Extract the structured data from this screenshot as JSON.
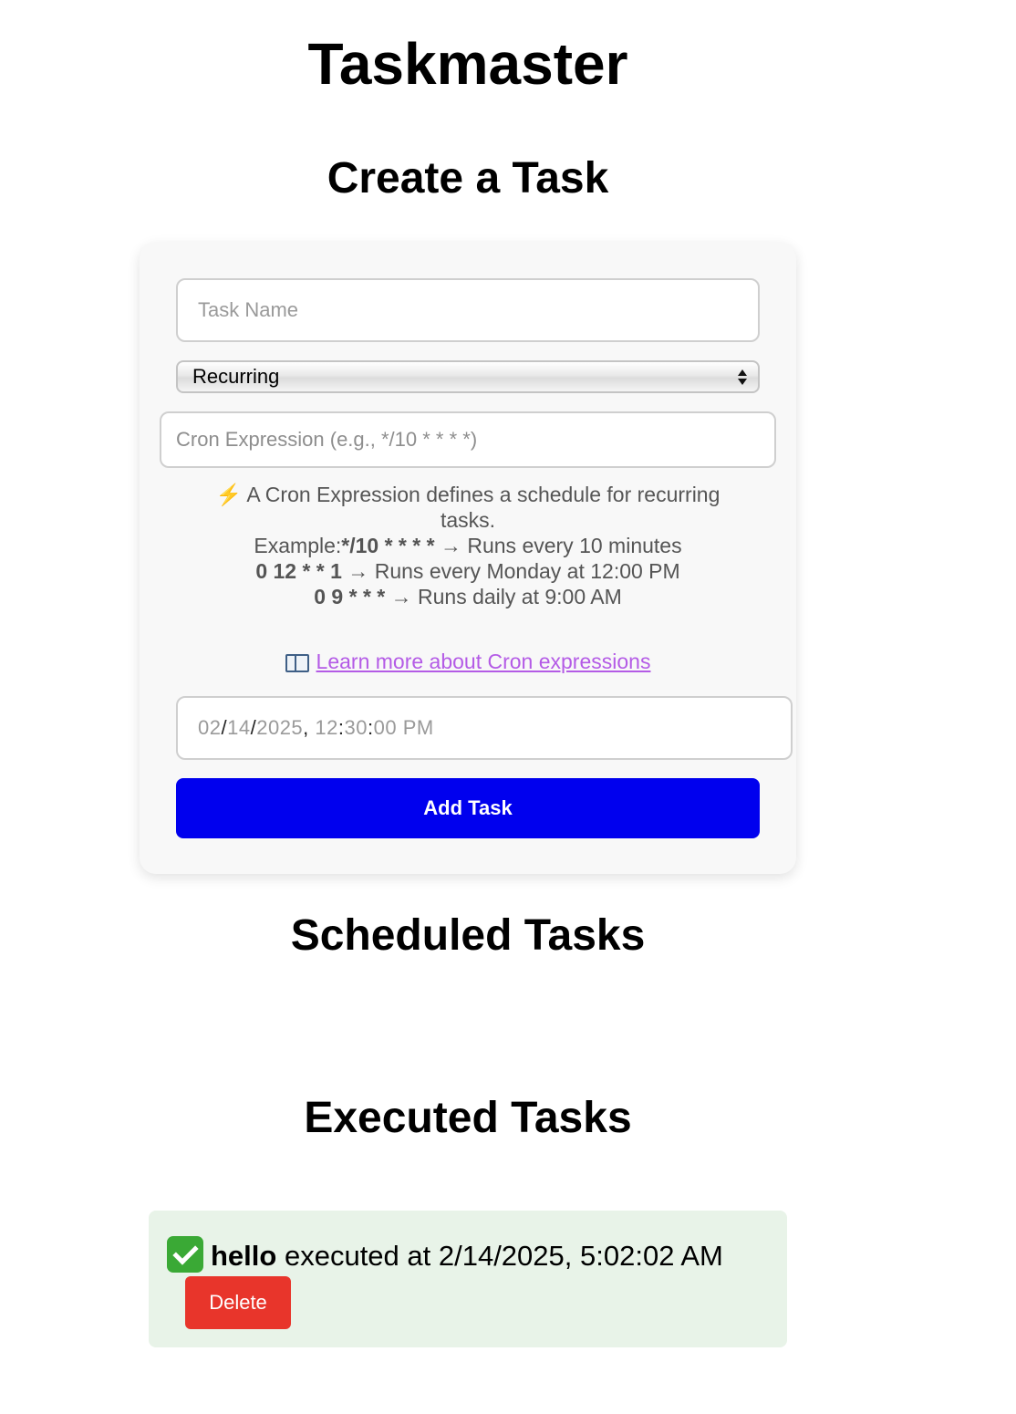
{
  "app": {
    "title": "Taskmaster"
  },
  "create": {
    "title": "Create a Task",
    "task_name_placeholder": "Task Name",
    "task_name_value": "",
    "type_select": {
      "selected": "Recurring",
      "icon": "updown-arrows-icon"
    },
    "cron_placeholder": "Cron Expression (e.g., */10 * * * *)",
    "cron_value": "",
    "help": {
      "icon": "lightning-bolt-icon",
      "bolt_glyph": "⚡",
      "intro": "A Cron Expression defines a schedule for recurring tasks.",
      "example_prefix": "Example:",
      "examples": [
        {
          "expr": "*/10 * * * *",
          "desc": "→ Runs every 10 minutes"
        },
        {
          "expr": "0 12 * * 1",
          "desc": "→ Runs every Monday at 12:00 PM"
        },
        {
          "expr": "0 9 * * *",
          "desc": "→ Runs daily at 9:00 AM"
        }
      ]
    },
    "learn_more": {
      "icon": "open-book-icon",
      "label": "Learn more about Cron expressions"
    },
    "datetime": {
      "month": "02",
      "day": "14",
      "year": "2025",
      "hour": "12",
      "minute": "30",
      "second": "00",
      "period": "PM"
    },
    "submit_label": "Add Task"
  },
  "scheduled": {
    "title": "Scheduled Tasks",
    "items": []
  },
  "executed": {
    "title": "Executed Tasks",
    "items": [
      {
        "icon": "check-mark-icon",
        "name": "hello",
        "text": "executed at 2/14/2025, 5:02:02 AM",
        "delete_label": "Delete"
      }
    ]
  },
  "colors": {
    "primary_button": "#0000ee",
    "delete_button": "#e8352b",
    "executed_bg": "#e8f3e8",
    "link": "#b45be6"
  }
}
